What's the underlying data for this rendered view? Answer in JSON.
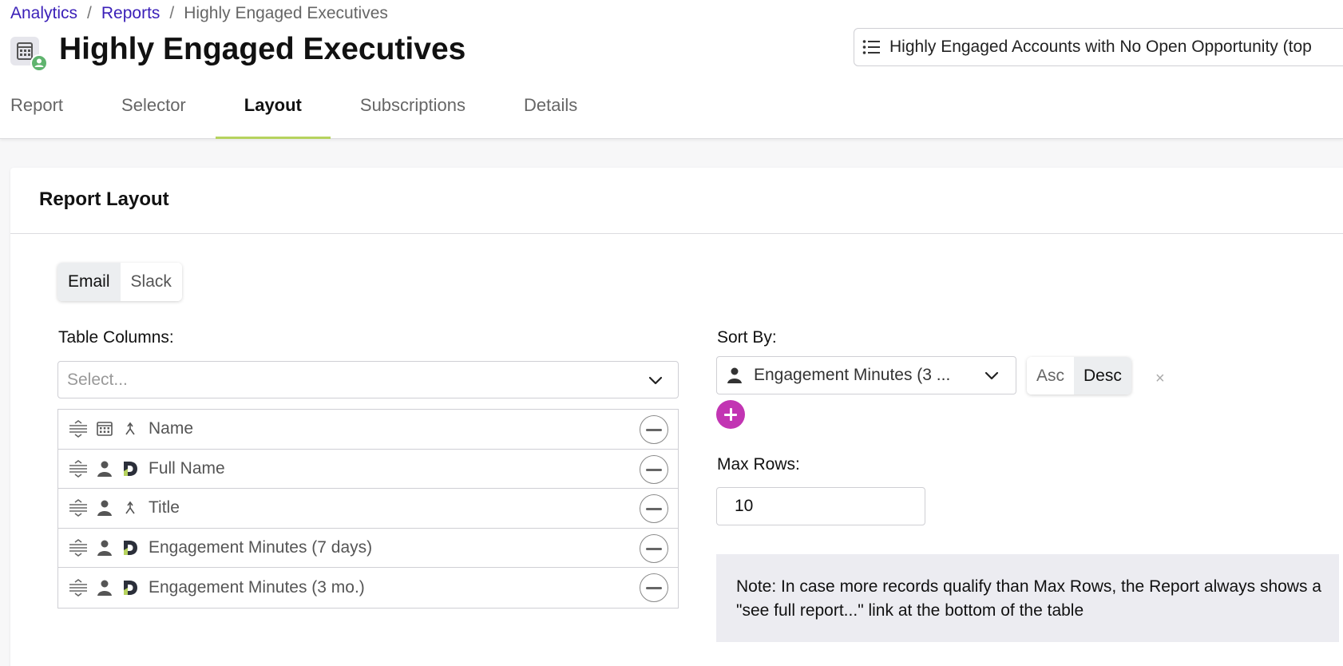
{
  "breadcrumb": {
    "item1": "Analytics",
    "item2": "Reports",
    "current": "Highly Engaged Executives",
    "separator": "/"
  },
  "header": {
    "title": "Highly Engaged Executives",
    "selector_value": "Highly Engaged Accounts with No Open Opportunity (top"
  },
  "tabs": [
    {
      "label": "Report"
    },
    {
      "label": "Selector"
    },
    {
      "label": "Layout"
    },
    {
      "label": "Subscriptions"
    },
    {
      "label": "Details"
    }
  ],
  "card": {
    "title": "Report Layout"
  },
  "channel_toggle": {
    "email": "Email",
    "slack": "Slack",
    "selected": "Email"
  },
  "table_columns": {
    "label": "Table Columns:",
    "placeholder": "Select...",
    "rows": [
      {
        "name": "Name",
        "type_icon": "building-icon",
        "source_icon": "merge-icon"
      },
      {
        "name": "Full Name",
        "type_icon": "person-icon",
        "source_icon": "d-logo-icon"
      },
      {
        "name": "Title",
        "type_icon": "person-icon",
        "source_icon": "merge-icon"
      },
      {
        "name": "Engagement Minutes (7 days)",
        "type_icon": "person-icon",
        "source_icon": "d-logo-icon"
      },
      {
        "name": "Engagement Minutes (3 mo.)",
        "type_icon": "person-icon",
        "source_icon": "d-logo-icon"
      }
    ]
  },
  "sort_by": {
    "label": "Sort By:",
    "value": "Engagement Minutes (3 ...",
    "asc": "Asc",
    "desc": "Desc",
    "selected": "Desc",
    "clear": "×"
  },
  "max_rows": {
    "label": "Max Rows:",
    "value": "10"
  },
  "note": {
    "text": "Note: In case more records qualify than Max Rows, the Report always shows a \"see full report...\" link at the bottom of the table"
  },
  "colors": {
    "link": "#3a1fb8",
    "tab_underline": "#b6d35e",
    "add_button": "#c235b3",
    "note_bg": "#ececf1",
    "badge": "#5fb46e"
  }
}
